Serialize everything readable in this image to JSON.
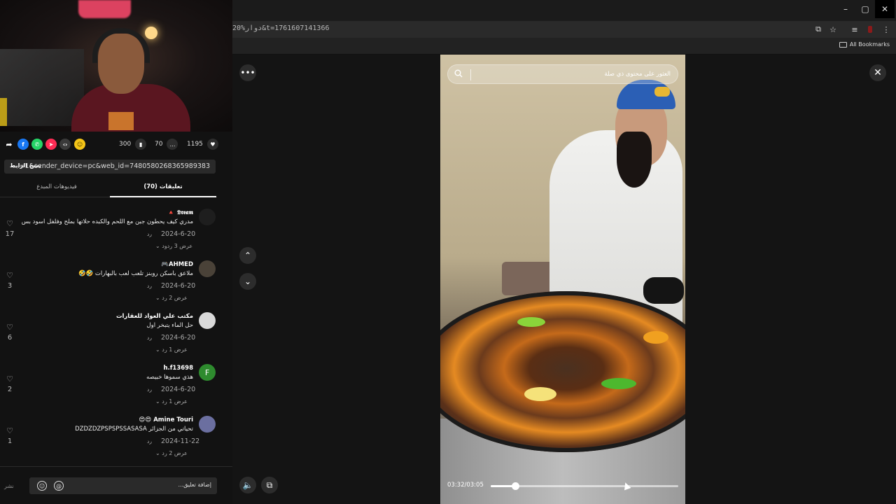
{
  "browser": {
    "url": "20%دوار&t=1761607141366",
    "bookmarks_label": "All Bookmarks",
    "window_controls": [
      "–",
      "▢",
      "✕"
    ]
  },
  "share": {
    "icons": [
      "share-arrow-icon",
      "facebook-icon",
      "whatsapp-icon",
      "telegram-icon",
      "embed-icon",
      "emoji-icon"
    ],
    "saves": "300",
    "comments": "70",
    "likes": "1195"
  },
  "link": {
    "copy_label": "نسخ الرابط",
    "url": "...=1&sender_device=pc&web_id=7480580268365989383"
  },
  "tabs": {
    "creator_videos": "فيديوهات المبدع",
    "comments": "(70) تعليقات"
  },
  "comments": [
    {
      "user": "𝕯𝖗𝖊𝖆𝖒 🔺",
      "text": "مدري كيف يحطون جبن مع اللحم والكبده حلاتها بملح وفلفل اسود بس",
      "date": "2024-6-20",
      "reply": "رد",
      "view_replies": "عرض 3 ردود",
      "likes": "17",
      "avatar_letter": ""
    },
    {
      "user": "AHMED🎮",
      "text": "ملاعق باسكن روبنز تلعب لعب بالبهارات 🤣🤣",
      "date": "2024-6-20",
      "reply": "رد",
      "view_replies": "عرض 2 رد",
      "likes": "3",
      "avatar_letter": ""
    },
    {
      "user": "مكتب علي العواد للعقارات",
      "text": "حل الماء يتبخر اول",
      "date": "2024-6-20",
      "reply": "رد",
      "view_replies": "عرض 1 رد",
      "likes": "6",
      "avatar_letter": ""
    },
    {
      "user": "h.f13698",
      "text": "هذي سموها خبيصه",
      "date": "2024-6-20",
      "reply": "رد",
      "view_replies": "عرض 1 رد",
      "likes": "2",
      "avatar_letter": "F"
    },
    {
      "user": "Amine Touri 😍😍",
      "text": "تحياتي من الجزائر DZDZDZPSPSPSSASASA",
      "date": "2024-11-22",
      "reply": "رد",
      "view_replies": "عرض 2 رد",
      "likes": "1",
      "avatar_letter": ""
    }
  ],
  "comment_input": {
    "placeholder": "إضافة تعليق...",
    "post_label": "نشر"
  },
  "viewer": {
    "search_placeholder": "العثور على محتوى ذي صلة",
    "time": "03:32/03:05",
    "progress_fraction": 0.13
  },
  "colors": {
    "accent": "#fe2c55",
    "facebook": "#1877f2",
    "whatsapp": "#25d366",
    "telegram": "#fe2c55",
    "emoji": "#f5c518",
    "avatar_green": "#2e8b2e"
  }
}
